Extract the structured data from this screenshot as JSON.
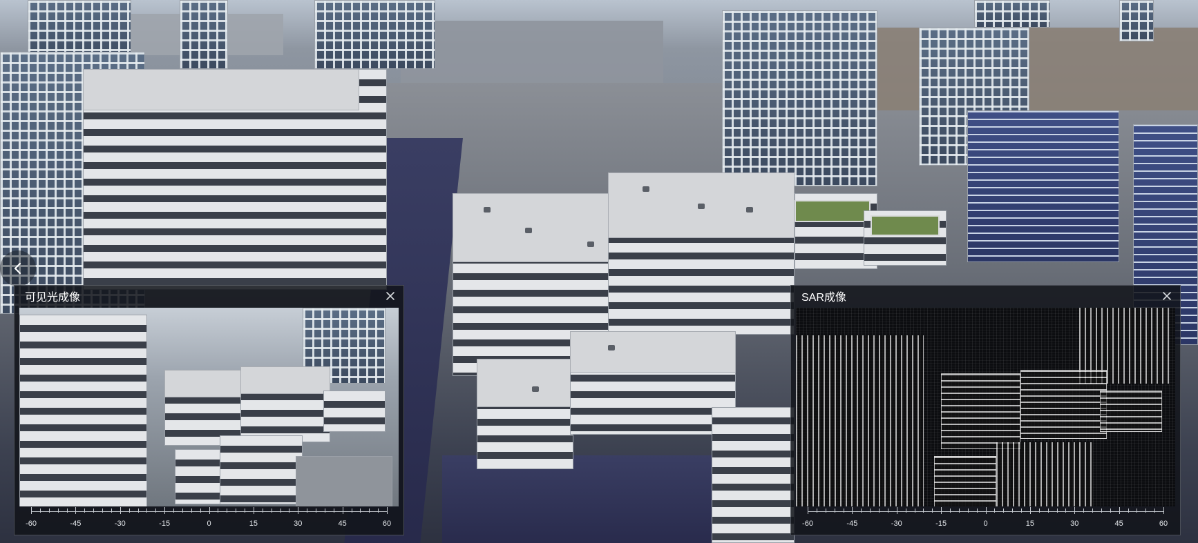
{
  "scene": {
    "description_name": "3d-city-view"
  },
  "nav": {
    "back_icon": "chevron-left-icon"
  },
  "panels": {
    "optical": {
      "title": "可见光成像",
      "close_icon": "close-icon",
      "axis_ticks": [
        "-60",
        "-45",
        "-30",
        "-15",
        "0",
        "15",
        "30",
        "45",
        "60"
      ]
    },
    "sar": {
      "title": "SAR成像",
      "close_icon": "close-icon",
      "axis_ticks": [
        "-60",
        "-45",
        "-30",
        "-15",
        "0",
        "15",
        "30",
        "45",
        "60"
      ]
    }
  },
  "colors": {
    "panel_bg": "#12141a",
    "panel_title": "#ffffff",
    "axis_text": "#e3e6ea"
  }
}
